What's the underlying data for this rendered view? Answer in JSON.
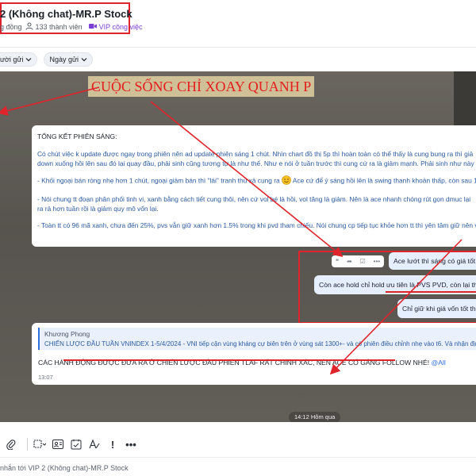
{
  "header": {
    "title": "2 (Không chat)-MR.P Stock",
    "community": "g đồng",
    "members": "133 thành viên",
    "vip": "VIP công việc"
  },
  "filters": {
    "sender": "ười gửi",
    "date": "Ngày gửi"
  },
  "banner": "CUỘC SỐNG CHỈ XOAY QUANH P",
  "summary": {
    "heading": "TỔNG KẾT PHIÊN SÁNG:",
    "p1a": "Có chút việc k update được ngay trong phiên nên ad update phiên sáng 1 chút. Nhìn chart đồ thị 5p thì hoàn toàn có thể thấy là cung bung ra thì giả",
    "p1b": "down xuống hồi lên sau đó lại quay đầu, phải sinh cũng tương tự là như thế. Như e nói ở tuần trước thì cung cứ ra là giảm mạnh. Phải sinh như này h",
    "p2a": "- Khối ngoại bán ròng nhẹ hơn 1 chút, ngoại giảm bán thì \"lái\" tranh thủ xả cung ra",
    "p2b": "Ace cứ để ý sáng hồi lên là swing thanh khoản thấp, còn sau 1",
    "p3a": "- Nói chung tt đoạn phân phối tinh vi, xanh bằng cách tiết cung thôi, nên cứ vol bé là hồi, vol tăng là giảm. Nên là ace nhanh chóng rút gọn dmuc lại",
    "p3b": "ra rả hơn tuần rồi là giảm quy mô vốn lại.",
    "p4": "- Toàn tt có 96 mã xanh, chưa đến 25%, pvs vẫn giữ xanh hơn 1.5% trong khi pvd tham chiếu. Nói chung cp tiếp tục khỏe hơn tt thì yên tâm giữ nên v"
  },
  "bubbles": {
    "b1": "Ace lướt thì sáng có giá tốt",
    "b2": "Còn ace hold chỉ hold ưu tiên là PVS PVD, còn lại thì l",
    "b3": "Chỉ giữ khi giá vốn tốt th"
  },
  "reply": {
    "quote_name": "Khương Phong",
    "quote_text": "CHIẾN LƯỢC ĐẦU TUẦN VNINDEX 1-5/4/2024 - VNI tiếp cận vùng kháng cự biên trên ở vùng sát 1300+- và có phiên điều chỉnh nhẹ vào t6. Và nhận định và",
    "message": "CÁC HÀNH ĐỘNG ĐƯỢC ĐƯA RA Ở CHIẾN LƯỢC ĐẦU PHIÊN TLAF RẤT CHÍNH XÁC, NÊN ACE CỐ GẮNG FOLLOW NHÉ!",
    "mention": "@All",
    "time": "13:07"
  },
  "date_divider": "14:12 Hôm qua",
  "composer": {
    "placeholder": "nhắn tới VIP 2 (Không chat)-MR.P Stock"
  },
  "icons": {
    "members": "user-icon",
    "vip": "video-icon",
    "emoji": "wink-emoji"
  },
  "colors": {
    "highlight_red": "#e0242b",
    "vip_purple": "#7b40d8",
    "link_blue": "#2b6fe0",
    "banner_bg": "#cfc097"
  }
}
